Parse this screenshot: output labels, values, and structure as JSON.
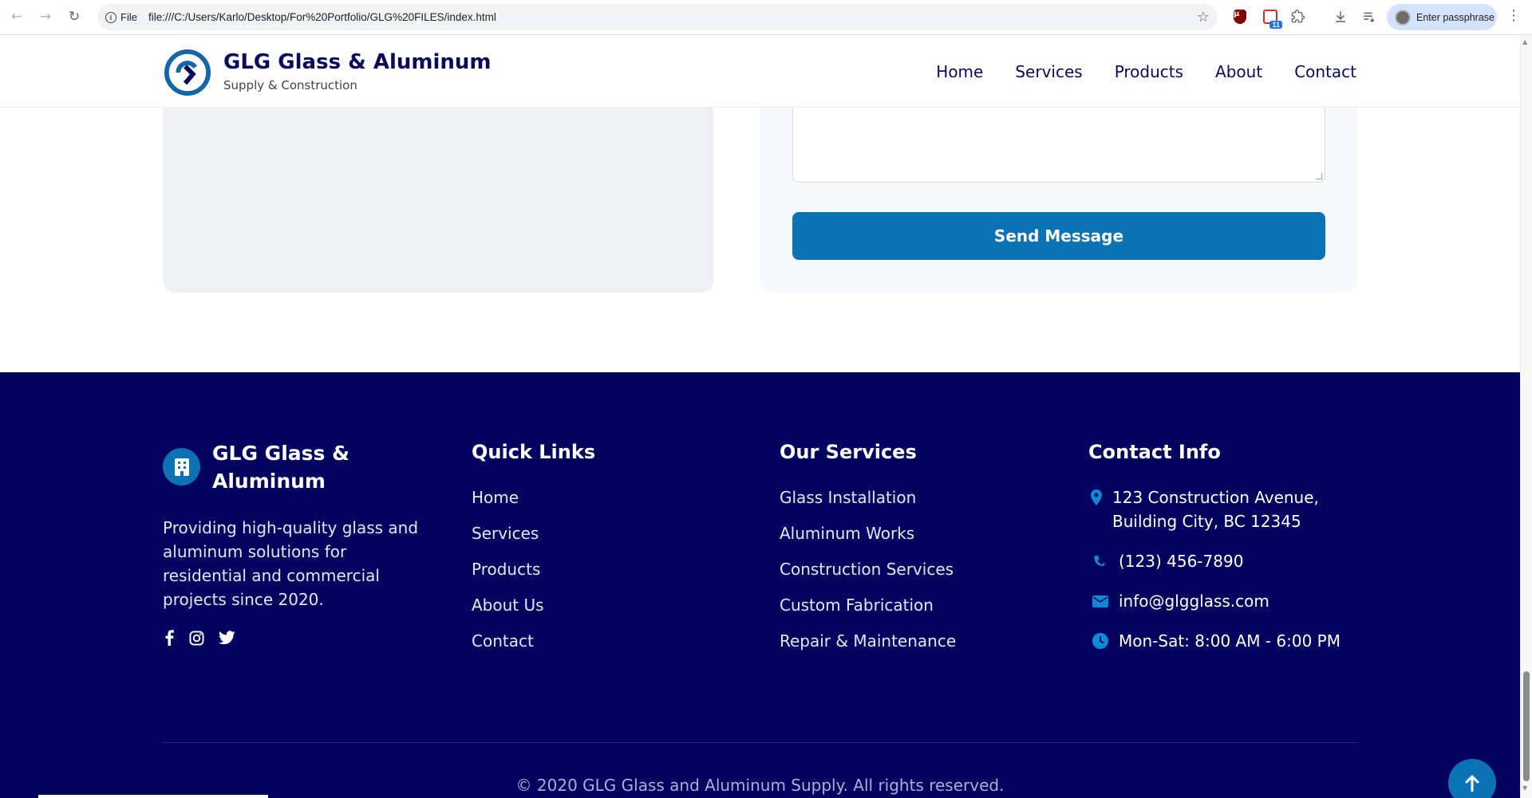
{
  "browser": {
    "address_label": "File",
    "url": "file:///C:/Users/Karlo/Desktop/For%20Portfolio/GLG%20FILES/index.html",
    "extension_badge": "11",
    "profile_label": "Enter passphrase",
    "icons": [
      "back-icon",
      "forward-icon",
      "reload-icon",
      "info-icon",
      "star-icon",
      "ublock-icon",
      "extension-icon",
      "puzzle-icon",
      "download-icon",
      "reading-list-icon",
      "menu-icon"
    ]
  },
  "header": {
    "brand_name": "GLG Glass & Aluminum",
    "brand_tagline": "Supply & Construction",
    "nav": [
      "Home",
      "Services",
      "Products",
      "About",
      "Contact"
    ]
  },
  "contact_form": {
    "send_label": "Send Message"
  },
  "footer": {
    "brand_name": "GLG Glass & Aluminum",
    "description": "Providing high-quality glass and aluminum solutions for residential and commercial projects since 2020.",
    "social": [
      "facebook-icon",
      "instagram-icon",
      "twitter-icon"
    ],
    "quick_links": {
      "heading": "Quick Links",
      "items": [
        "Home",
        "Services",
        "Products",
        "About Us",
        "Contact"
      ]
    },
    "services": {
      "heading": "Our Services",
      "items": [
        "Glass Installation",
        "Aluminum Works",
        "Construction Services",
        "Custom Fabrication",
        "Repair & Maintenance"
      ]
    },
    "contact": {
      "heading": "Contact Info",
      "address_line1": "123 Construction Avenue,",
      "address_line2": "Building City, BC 12345",
      "phone": "(123) 456-7890",
      "email": "info@glgglass.com",
      "hours": "Mon-Sat: 8:00 AM - 6:00 PM"
    },
    "copyright": "© 2020 GLG Glass and Aluminum Supply. All rights reserved."
  },
  "colors": {
    "footer_bg": "#03035f",
    "accent": "#0b73b3",
    "brand_text": "#0a0a5c"
  }
}
